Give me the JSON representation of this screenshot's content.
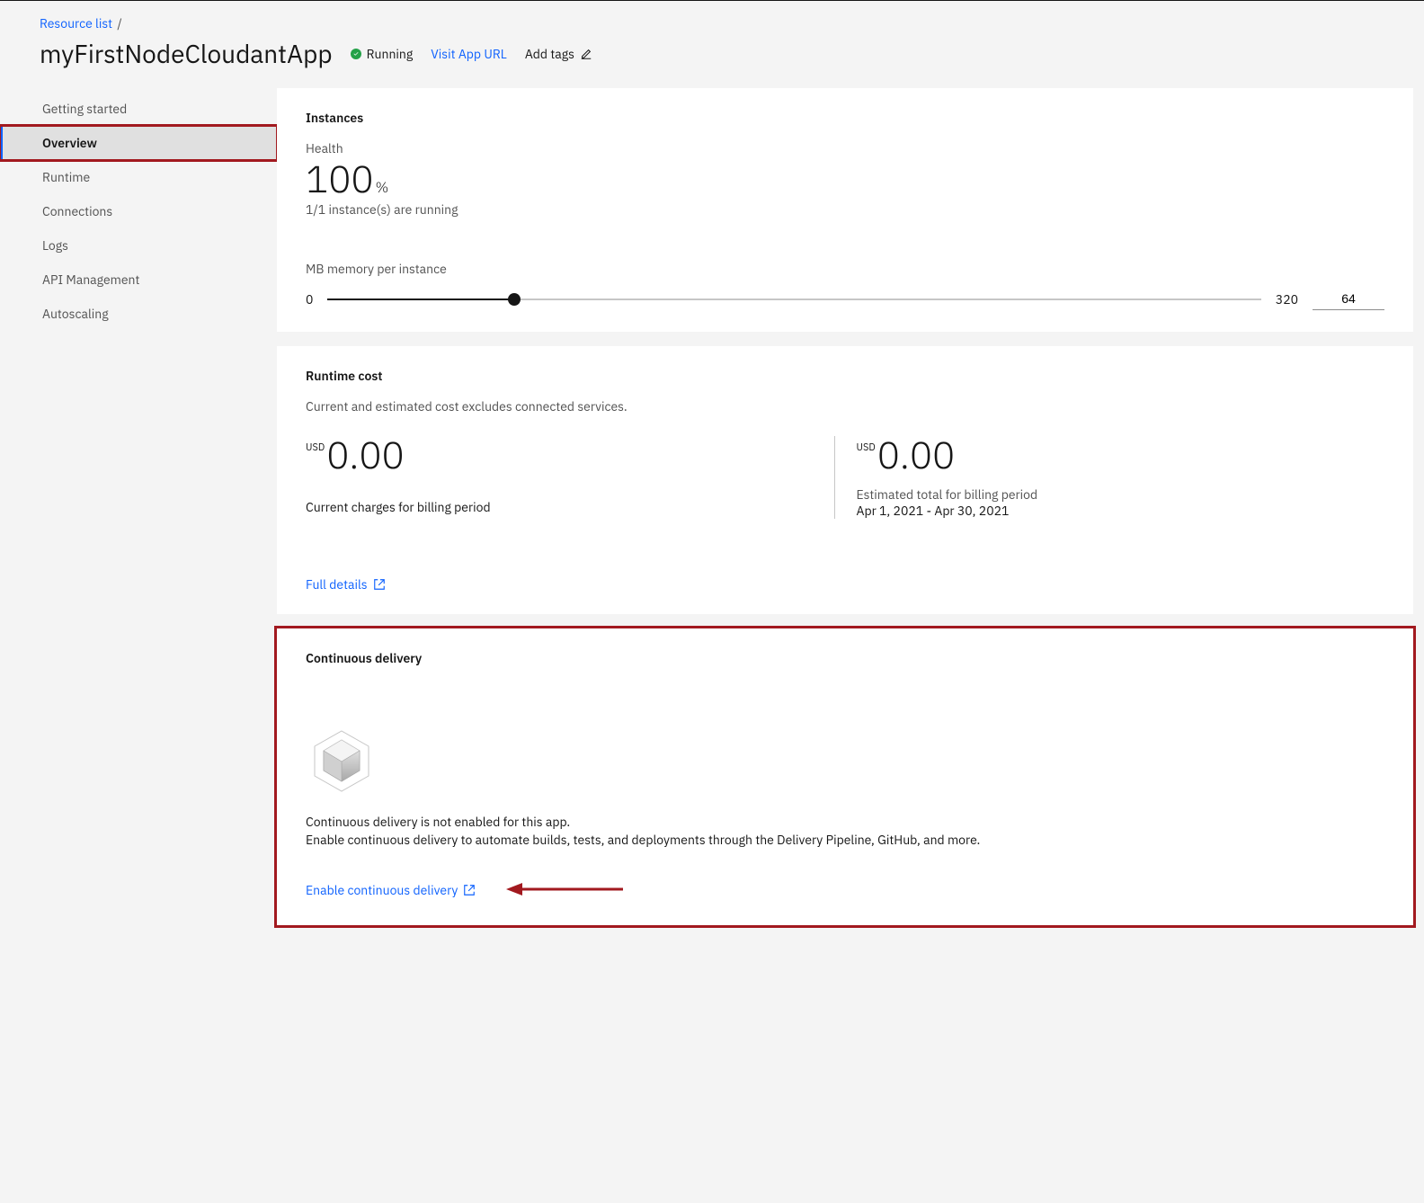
{
  "breadcrumb": {
    "root": "Resource list",
    "sep": "/"
  },
  "header": {
    "title": "myFirstNodeCloudantApp",
    "status_label": "Running",
    "visit_url_label": "Visit App URL",
    "add_tags_label": "Add tags"
  },
  "sidebar": {
    "items": [
      {
        "label": "Getting started"
      },
      {
        "label": "Overview"
      },
      {
        "label": "Runtime"
      },
      {
        "label": "Connections"
      },
      {
        "label": "Logs"
      },
      {
        "label": "API Management"
      },
      {
        "label": "Autoscaling"
      }
    ]
  },
  "instances": {
    "heading": "Instances",
    "health_label": "Health",
    "health_value": "100",
    "health_unit": "%",
    "health_sub": "1/1 instance(s) are running",
    "memory_label": "MB memory per instance",
    "memory_min": "0",
    "memory_max": "320",
    "memory_value": "64"
  },
  "runtime_cost": {
    "heading": "Runtime cost",
    "subtitle": "Current and estimated cost excludes connected services.",
    "currency": "USD",
    "current_value": "0.00",
    "current_label": "Current charges for billing period",
    "estimated_value": "0.00",
    "estimated_label": "Estimated total for billing period",
    "period": "Apr 1, 2021 - Apr 30, 2021",
    "full_details_label": "Full details"
  },
  "cd": {
    "heading": "Continuous delivery",
    "not_enabled": "Continuous delivery is not enabled for this app.",
    "description": "Enable continuous delivery to automate builds, tests, and deployments through the Delivery Pipeline, GitHub, and more.",
    "enable_label": "Enable continuous delivery"
  }
}
